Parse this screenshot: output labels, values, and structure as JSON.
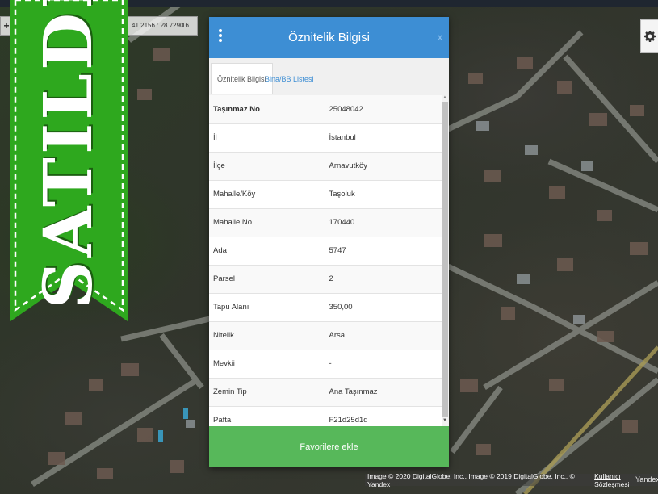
{
  "map": {
    "coordinates": "41.2156 : 28.7290",
    "zoom": "16",
    "zoom_in_icon": "plus-icon",
    "settings_icon": "gear-icon",
    "attribution": "Image © 2020 DigitalGlobe, Inc., Image © 2019 DigitalGlobe, Inc., © Yandex",
    "attribution_link": "Kullanıcı Sözleşmesi",
    "provider": "Yandex"
  },
  "banner": {
    "text": "SATILDI",
    "color": "#2ea81e"
  },
  "panel": {
    "title": "Öznitelik Bilgisi",
    "menu_icon": "vertical-dots-icon",
    "close_label": "x",
    "header_color": "#3d8ed4",
    "tabs": [
      {
        "label": "Öznitelik Bilgisi",
        "active": true
      },
      {
        "label": "Bina/BB Listesi",
        "active": false
      }
    ],
    "rows": [
      {
        "key": "Taşınmaz No",
        "value": "25048042"
      },
      {
        "key": "İl",
        "value": "İstanbul"
      },
      {
        "key": "İlçe",
        "value": "Arnavutköy"
      },
      {
        "key": "Mahalle/Köy",
        "value": "Taşoluk"
      },
      {
        "key": "Mahalle No",
        "value": "170440"
      },
      {
        "key": "Ada",
        "value": "5747"
      },
      {
        "key": "Parsel",
        "value": "2"
      },
      {
        "key": "Tapu Alanı",
        "value": "350,00"
      },
      {
        "key": "Nitelik",
        "value": "Arsa"
      },
      {
        "key": "Mevkii",
        "value": "-"
      },
      {
        "key": "Zemin Tip",
        "value": "Ana Taşınmaz"
      },
      {
        "key": "Pafta",
        "value": "F21d25d1d"
      }
    ],
    "favorite_button": "Favorilere ekle",
    "favorite_color": "#57b85a"
  }
}
